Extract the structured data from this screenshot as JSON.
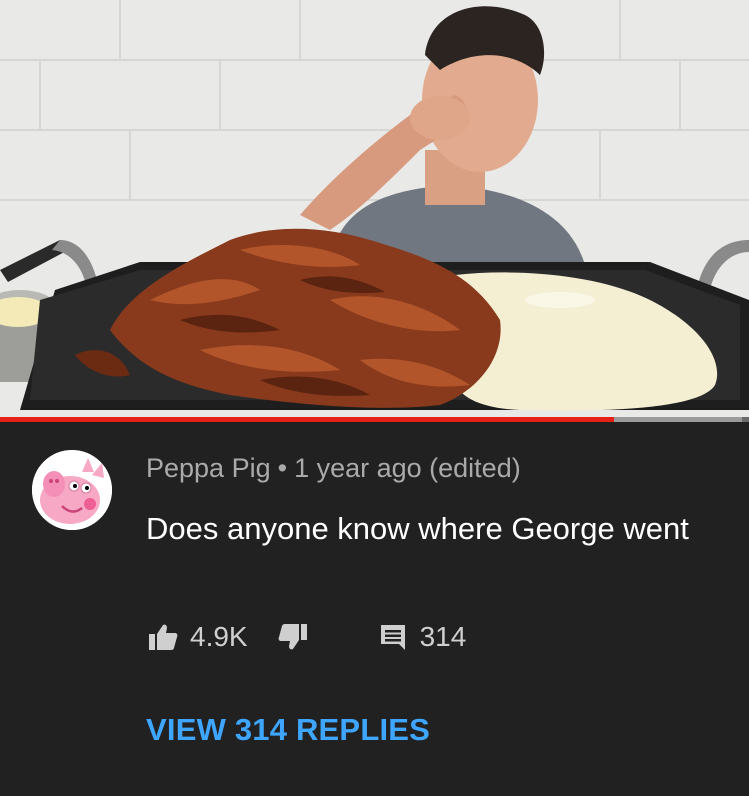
{
  "video": {
    "progress_fraction": 0.82,
    "buffer_fraction": 0.99
  },
  "comment": {
    "author": "Peppa Pig",
    "separator": "•",
    "time": "1 year ago (edited)",
    "text": "Does anyone know where George went",
    "likes": "4.9K",
    "reply_count": "314",
    "view_replies_label": "VIEW 314 REPLIES",
    "avatar_icon": "peppa-pig-avatar-icon"
  },
  "colors": {
    "background": "#212121",
    "accent_red": "#e62117",
    "link_blue": "#3ea6ff",
    "meta_gray": "#aaaaaa"
  }
}
